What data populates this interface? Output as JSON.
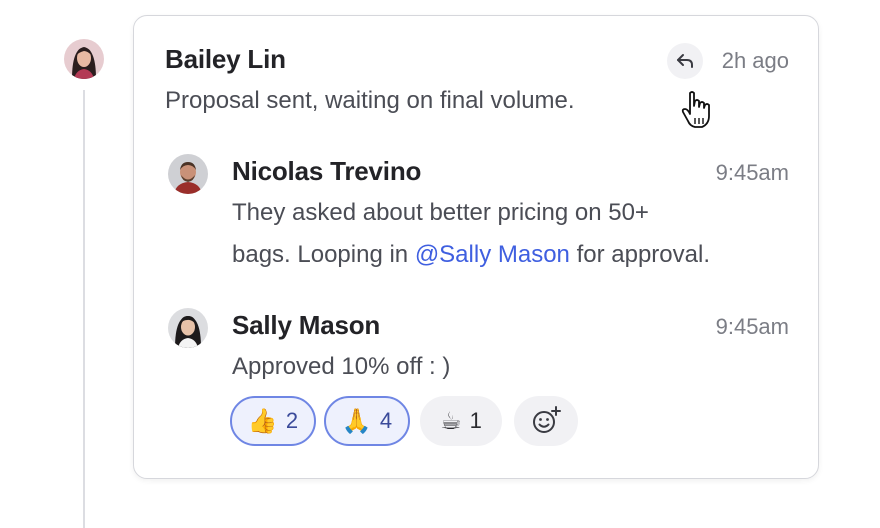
{
  "parent": {
    "author": "Bailey Lin",
    "time": "2h ago",
    "text": "Proposal sent, waiting on final volume."
  },
  "replies": [
    {
      "author": "Nicolas Trevino",
      "time": "9:45am",
      "text_line1": "They asked about better pricing on 50+",
      "text_line2_before": "bags. Looping in ",
      "mention": "@Sally Mason",
      "text_line2_after": " for approval."
    },
    {
      "author": "Sally Mason",
      "time": "9:45am",
      "text": "Approved 10% off : )"
    }
  ],
  "reactions": [
    {
      "emoji": "👍",
      "count": "2",
      "active": true
    },
    {
      "emoji": "🙏",
      "count": "4",
      "active": true
    },
    {
      "emoji": "☕",
      "count": "1",
      "active": false
    }
  ],
  "colors": {
    "accent": "#3f5fe0",
    "mention": "#3f5fe0",
    "reaction_active_border": "#6f86e4"
  },
  "icons": [
    "reply-icon",
    "add-reaction-icon",
    "hand-cursor-icon"
  ]
}
